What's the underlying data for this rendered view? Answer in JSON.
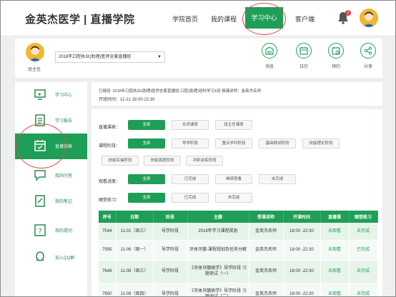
{
  "header": {
    "brand": "金英杰医学 | 直播学院",
    "nav": [
      {
        "label": "学院首页"
      },
      {
        "label": "我的课程"
      },
      {
        "label": "学习中心"
      },
      {
        "label": "客户端"
      }
    ],
    "notification_count": "2"
  },
  "subbar": {
    "teacher_label": "班主任",
    "course_select": "2018年口腔执业(助理)医师全套直播班",
    "quick_actions": [
      {
        "label": "消息",
        "icon": "message-icon"
      },
      {
        "label": "日历",
        "icon": "calendar-icon"
      },
      {
        "label": "预约",
        "icon": "appointment-icon"
      },
      {
        "label": "分享",
        "icon": "share-icon"
      }
    ]
  },
  "sidebar": {
    "items": [
      {
        "label": "学习中心",
        "icon": "monitor-icon"
      },
      {
        "label": "学习报告",
        "icon": "report-icon"
      },
      {
        "label": "直播课表",
        "icon": "schedule-icon"
      },
      {
        "label": "我的问答",
        "icon": "chat-icon"
      },
      {
        "label": "我的笔记",
        "icon": "note-icon"
      },
      {
        "label": "我的提问",
        "icon": "question-icon"
      },
      {
        "label": "加入QQ群",
        "icon": "qq-icon"
      }
    ]
  },
  "main": {
    "info_line": "已报班: 2018年口腔执业(助理)医师全套直播班-口腔(助理)班科学习1班 授课讲师：金英杰名师",
    "time_line": "开班时间：11-21 18:00-22:30",
    "filters": [
      {
        "label": "直播课表：",
        "options": [
          "全部",
          "名师课表",
          "班主任课表"
        ],
        "selected": 0
      },
      {
        "label": "课程阶段：",
        "options": [
          "全部",
          "导学阶段",
          "重点学科阶段",
          "基础精讲阶段",
          "技能理论阶段"
        ],
        "selected": 0
      },
      {
        "label": "",
        "options": [
          "技能实操阶段",
          "技能真题阶段",
          "冲刺讲练阶段"
        ],
        "selected": -1
      },
      {
        "label": "观看进度：",
        "options": [
          "全部",
          "已完成",
          "继续观看",
          "未完成"
        ],
        "selected": 0
      },
      {
        "label": "随堂练习：",
        "options": [
          "全部",
          "已完成",
          "未完成"
        ],
        "selected": 0
      }
    ],
    "table": {
      "headers": [
        "序号",
        "日期",
        "阶段",
        "主题",
        "授课讲师",
        "开课时间",
        "直播课",
        "随堂练习"
      ],
      "rows": [
        [
          "7544",
          "11-01（周三）",
          "导学阶段",
          "2018年学习课程规划",
          "金英杰名师",
          "18:00 -22:30",
          "未观看",
          "未完成"
        ],
        [
          "7595",
          "11-06（周一）",
          "导学阶段",
          "牙体牙髓-课程规划及任务分解",
          "金英杰名师",
          "18:00 -22:30",
          "未观看",
          "已完成"
        ],
        [
          "7648",
          "11-08（周三）",
          "导学阶段",
          "《牙体牙髓病学》导学阶段 习题测试（一）",
          "金英杰名师",
          "18:00 -22:30",
          "未观看",
          "未完成"
        ],
        [
          "7650",
          "11-09（周四）",
          "导学阶段",
          "《牙体牙髓病学》导学阶段 习题测试（二）",
          "金英杰名师",
          "18:00 -22:30",
          "未观看",
          "未完成"
        ]
      ]
    }
  },
  "colors": {
    "accent": "#1e9e56",
    "annotation": "#e24a4a"
  }
}
